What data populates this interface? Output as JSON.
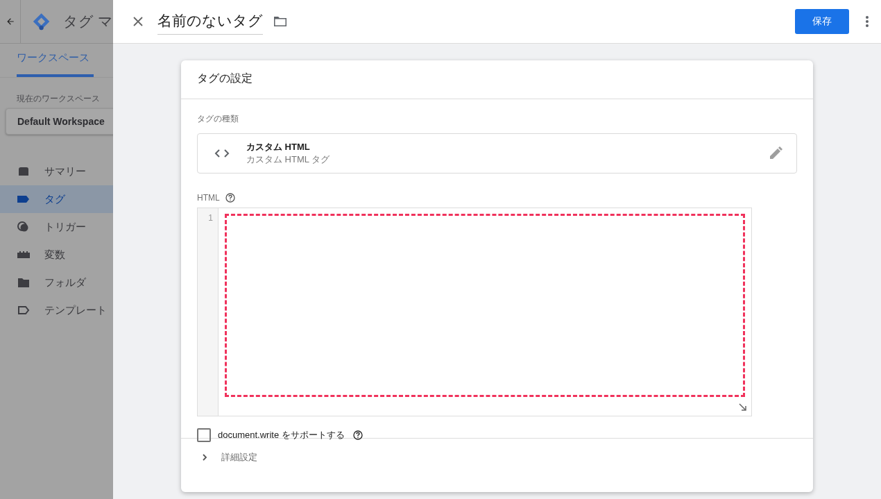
{
  "background_app": {
    "title": "タグ マ",
    "tabs": [
      {
        "label": "ワークスペース",
        "selected": true
      }
    ],
    "workspace_label": "現在のワークスペース",
    "workspace": "Default Workspace",
    "nav": [
      {
        "label": "サマリー",
        "kind": "summary",
        "selected": false
      },
      {
        "label": "タグ",
        "kind": "tag",
        "selected": true
      },
      {
        "label": "トリガー",
        "kind": "trigger",
        "selected": false
      },
      {
        "label": "変数",
        "kind": "variable",
        "selected": false
      },
      {
        "label": "フォルダ",
        "kind": "folder",
        "selected": false
      },
      {
        "label": "テンプレート",
        "kind": "template",
        "selected": false
      }
    ]
  },
  "panel": {
    "name": "名前のないタグ",
    "save_button": "保存",
    "card": {
      "title": "タグの設定",
      "type_label": "タグの種類",
      "type_name": "カスタム HTML",
      "type_description": "カスタム HTML タグ",
      "html_label": "HTML",
      "line_numbers": [
        "1"
      ],
      "document_write": {
        "label": "document.write をサポートする",
        "checked": false
      },
      "advanced": {
        "label": "詳細設定",
        "expanded": false
      }
    }
  }
}
